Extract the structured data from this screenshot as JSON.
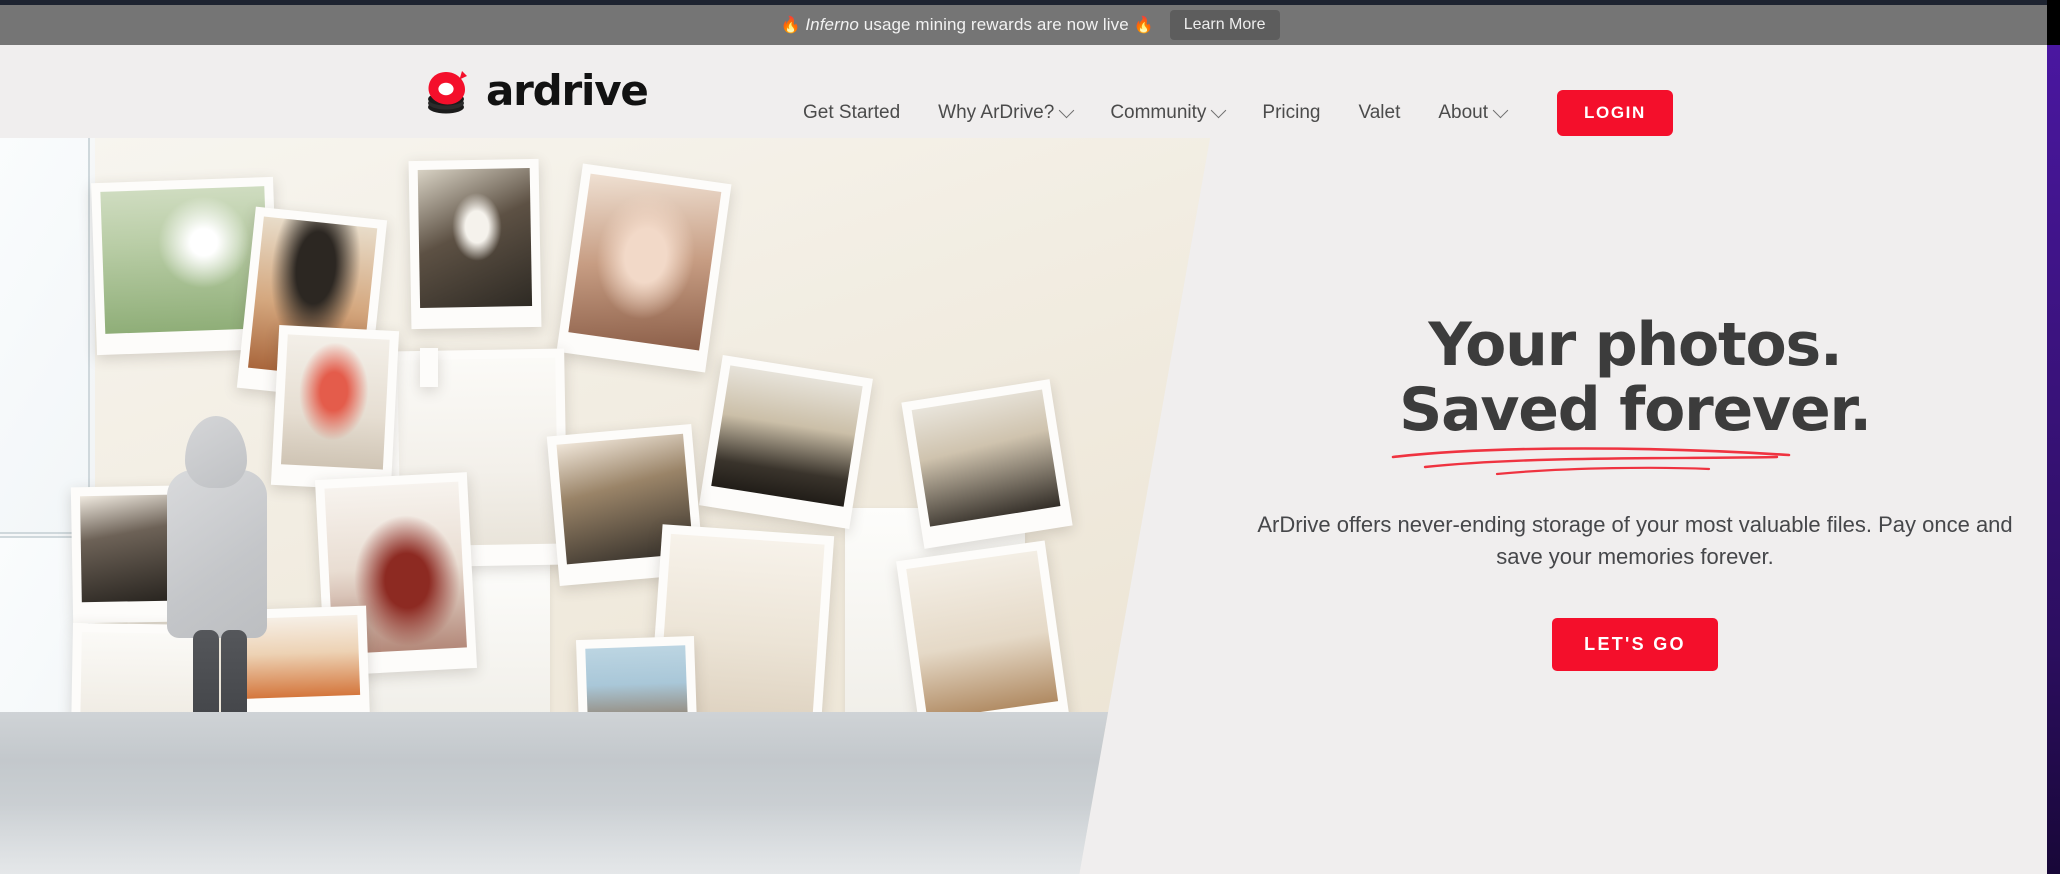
{
  "announcement": {
    "fire_icon_left": "🔥",
    "fire_icon_right": "🔥",
    "brand_word": "Inferno",
    "message": " usage mining rewards are now live ",
    "cta_label": "Learn More",
    "background_color": "#757575",
    "button_color": "#5d5d5d"
  },
  "header": {
    "logo_text": "ardrive",
    "logo_icon": "ardrive-disc-logo",
    "brand_red": "#f40f2b",
    "nav": [
      {
        "label": "Get Started",
        "has_dropdown": false
      },
      {
        "label": "Why ArDrive?",
        "has_dropdown": true
      },
      {
        "label": "Community",
        "has_dropdown": true
      },
      {
        "label": "Pricing",
        "has_dropdown": false
      },
      {
        "label": "Valet",
        "has_dropdown": false
      },
      {
        "label": "About",
        "has_dropdown": true
      }
    ],
    "login_label": "LOGIN"
  },
  "hero": {
    "title_line1": "Your photos.",
    "title_line2": "Saved forever.",
    "underline_color": "#ef3340",
    "subtitle": "ArDrive offers never-ending storage of your most valuable files. Pay once and save your memories forever.",
    "cta_label": "LET'S GO",
    "cta_color": "#f40f2b",
    "image_alt": "gallery-of-polaroid-photos-with-person-viewing"
  },
  "chrome": {
    "right_edge_color": "#3c1380"
  }
}
